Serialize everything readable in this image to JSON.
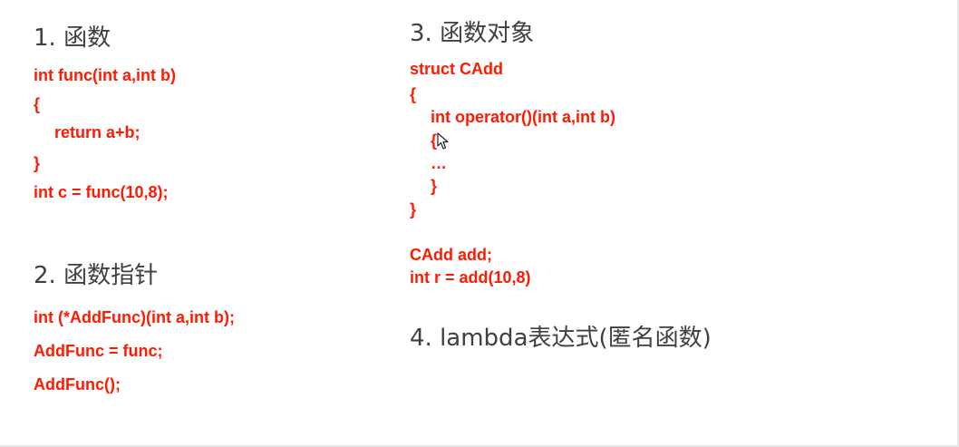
{
  "sections": [
    {
      "heading": "1. 函数",
      "code": [
        "int func(int a,int b)",
        "{",
        "return a+b;",
        "}",
        "int c = func(10,8);"
      ]
    },
    {
      "heading": "2. 函数指针",
      "code": [
        "int (*AddFunc)(int a,int b);",
        "AddFunc = func;",
        "AddFunc();"
      ]
    },
    {
      "heading": "3. 函数对象",
      "code": [
        "struct CAdd",
        "{",
        "int operator()(int a,int b)",
        "{",
        "…",
        "}",
        "}",
        "CAdd add;",
        "int r = add(10,8)"
      ]
    },
    {
      "heading": "4. lambda表达式(匿名函数)"
    }
  ]
}
